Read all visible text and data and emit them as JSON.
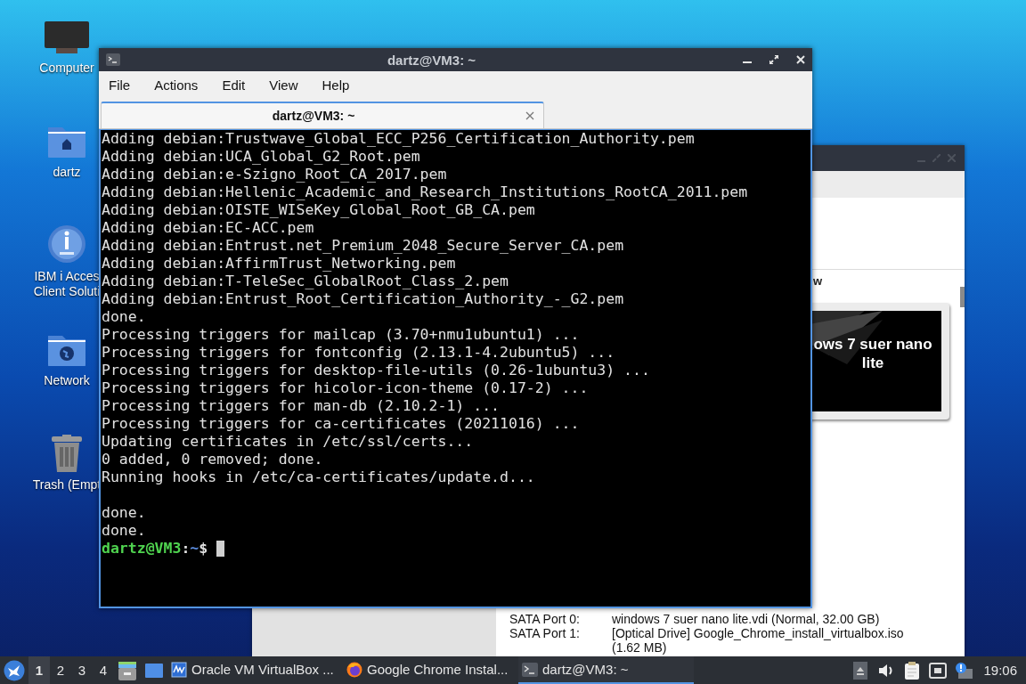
{
  "desktop_icons": [
    {
      "kind": "computer",
      "lines": [
        "Computer"
      ]
    },
    {
      "kind": "home",
      "lines": [
        "dartz"
      ]
    },
    {
      "kind": "ibm",
      "lines": [
        "IBM i Acces",
        "Client Soluti"
      ]
    },
    {
      "kind": "network",
      "lines": [
        "Network"
      ]
    },
    {
      "kind": "trash",
      "lines": [
        "Trash (Empt"
      ]
    }
  ],
  "background_window": {
    "heading_fragment": "w",
    "preview_text": "ows 7 suer nano lite",
    "storage": [
      {
        "name": "SATA Port 0:",
        "value": "windows 7 suer nano lite.vdi (Normal, 32.00 GB)"
      },
      {
        "name": "SATA Port 1:",
        "value": "[Optical Drive] Google_Chrome_install_virtualbox.iso (1.62 MB)"
      }
    ]
  },
  "terminal": {
    "title": "dartz@VM3: ~",
    "menu": [
      "File",
      "Actions",
      "Edit",
      "View",
      "Help"
    ],
    "tabs": [
      {
        "label": "dartz@VM3: ~",
        "selected": true
      }
    ],
    "lines": [
      "Adding debian:Trustwave_Global_ECC_P256_Certification_Authority.pem",
      "Adding debian:UCA_Global_G2_Root.pem",
      "Adding debian:e-Szigno_Root_CA_2017.pem",
      "Adding debian:Hellenic_Academic_and_Research_Institutions_RootCA_2011.pem",
      "Adding debian:OISTE_WISeKey_Global_Root_GB_CA.pem",
      "Adding debian:EC-ACC.pem",
      "Adding debian:Entrust.net_Premium_2048_Secure_Server_CA.pem",
      "Adding debian:AffirmTrust_Networking.pem",
      "Adding debian:T-TeleSec_GlobalRoot_Class_2.pem",
      "Adding debian:Entrust_Root_Certification_Authority_-_G2.pem",
      "done.",
      "Processing triggers for mailcap (3.70+nmu1ubuntu1) ...",
      "Processing triggers for fontconfig (2.13.1-4.2ubuntu5) ...",
      "Processing triggers for desktop-file-utils (0.26-1ubuntu3) ...",
      "Processing triggers for hicolor-icon-theme (0.17-2) ...",
      "Processing triggers for man-db (2.10.2-1) ...",
      "Processing triggers for ca-certificates (20211016) ...",
      "Updating certificates in /etc/ssl/certs...",
      "0 added, 0 removed; done.",
      "Running hooks in /etc/ca-certificates/update.d..."
    ],
    "lines_after_blank_line": [
      "done.",
      "done."
    ],
    "prompt": {
      "user_host": "dartz@VM3",
      "separator": ":",
      "path": "~",
      "symbol": "$"
    }
  },
  "taskbar": {
    "workspaces": [
      {
        "label": "1",
        "selected": true
      },
      {
        "label": "2",
        "selected": false
      },
      {
        "label": "3",
        "selected": false
      },
      {
        "label": "4",
        "selected": false
      }
    ],
    "launchers": [
      {
        "kind": "file-manager"
      },
      {
        "kind": "show-desktop"
      }
    ],
    "tasks": [
      {
        "kind": "virtualbox",
        "label": "Oracle VM VirtualBox ...",
        "selected": false
      },
      {
        "kind": "browser",
        "label": "Google Chrome Instal...",
        "selected": false
      },
      {
        "kind": "terminal",
        "label": "dartz@VM3: ~",
        "selected": true
      }
    ],
    "tray": [
      {
        "kind": "up-arrow"
      },
      {
        "kind": "volume"
      },
      {
        "kind": "clipboard"
      },
      {
        "kind": "network"
      },
      {
        "kind": "notification"
      }
    ],
    "clock": "19:06"
  }
}
